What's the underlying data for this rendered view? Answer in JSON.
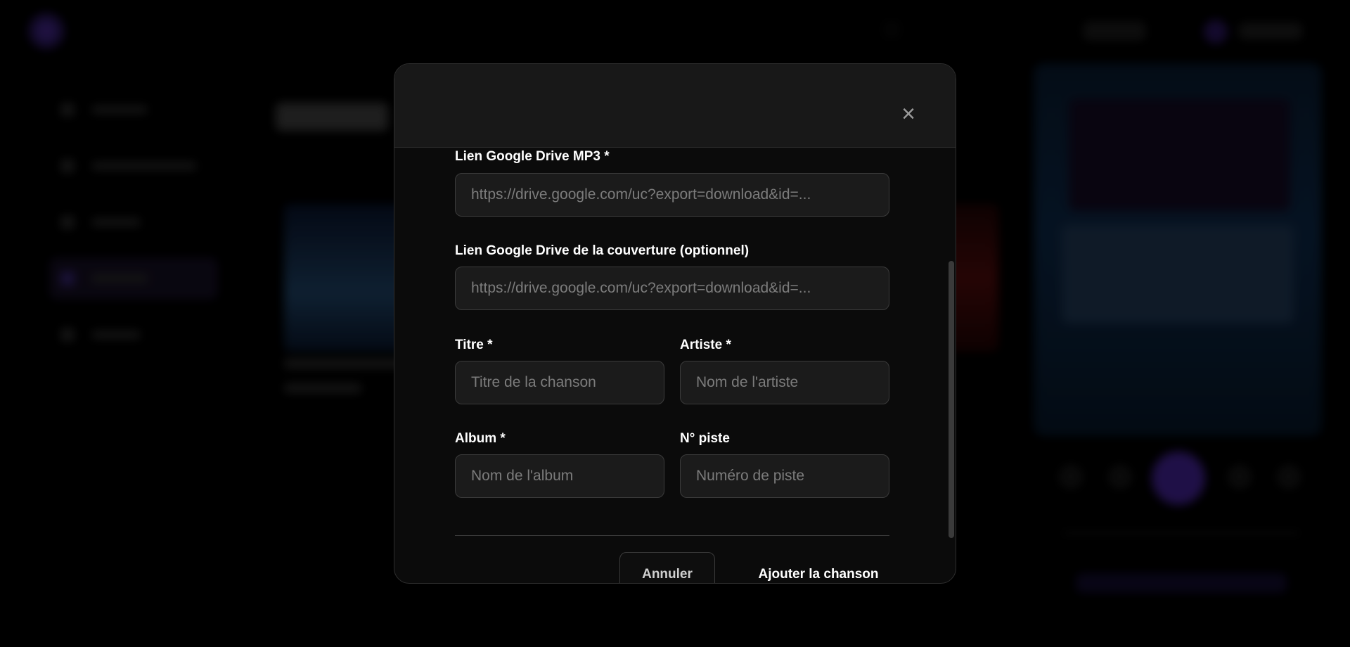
{
  "background": {
    "accent_color": "#5a2fc8",
    "sidebar_item_count": 5,
    "active_sidebar_index": 3
  },
  "modal": {
    "close_icon": "×",
    "fields": {
      "mp3_link": {
        "label": "Lien Google Drive MP3 *",
        "placeholder": "https://drive.google.com/uc?export=download&id=...",
        "value": ""
      },
      "cover_link": {
        "label": "Lien Google Drive de la couverture (optionnel)",
        "placeholder": "https://drive.google.com/uc?export=download&id=...",
        "value": ""
      },
      "title": {
        "label": "Titre *",
        "placeholder": "Titre de la chanson",
        "value": ""
      },
      "artist": {
        "label": "Artiste *",
        "placeholder": "Nom de l'artiste",
        "value": ""
      },
      "album": {
        "label": "Album *",
        "placeholder": "Nom de l'album",
        "value": ""
      },
      "track_number": {
        "label": "N° piste",
        "placeholder": "Numéro de piste",
        "value": ""
      }
    },
    "buttons": {
      "cancel": "Annuler",
      "submit": "Ajouter la chanson"
    }
  }
}
